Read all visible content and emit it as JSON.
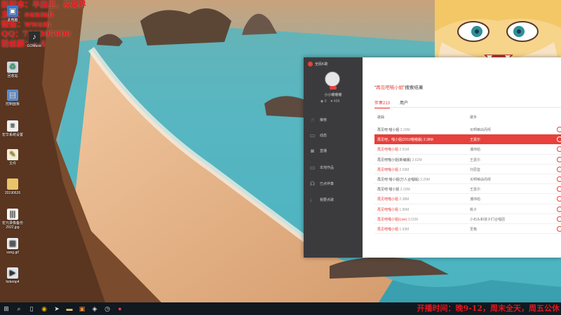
{
  "overlay": {
    "lines": [
      "新版本：半田里，灰莫界",
      "主播：eanmb",
      "微信：wwam",
      "QQ：739305908",
      "粉丝群：1.4"
    ]
  },
  "desktop_icons": [
    {
      "label": "此电脑",
      "icon": "computer-icon"
    },
    {
      "label": "GOMusic",
      "icon": "music-app-icon"
    },
    {
      "label": "回收站",
      "icon": "recycle-bin-icon"
    },
    {
      "label": "控制面板",
      "icon": "control-panel-icon"
    },
    {
      "label": "宏华系统设置",
      "icon": "settings-file-icon"
    },
    {
      "label": "文件",
      "icon": "file-icon"
    },
    {
      "label": "20190626",
      "icon": "folder-icon"
    },
    {
      "label": "宏元录像备份2922.jpg",
      "icon": "image-file-icon"
    },
    {
      "label": "song.gif",
      "icon": "image-file-icon"
    },
    {
      "label": "hidemp4",
      "icon": "video-file-icon"
    }
  ],
  "app": {
    "title": "全民K歌",
    "user": {
      "name": "小小暖暖暖",
      "followers": "0",
      "following": "439"
    },
    "nav": [
      {
        "label": "推荐",
        "icon": "thumb-icon"
      },
      {
        "label": "动态",
        "icon": "chat-icon"
      },
      {
        "label": "直播",
        "icon": "camera-icon"
      },
      {
        "label": "本地作品",
        "icon": "monitor-icon"
      },
      {
        "label": "已点伴奏",
        "icon": "headset-icon"
      },
      {
        "label": "我要点歌",
        "icon": "microphone-icon"
      }
    ],
    "search": {
      "keyword": "再见吧喵小姐",
      "suffix": "搜索结果"
    },
    "tabs": [
      {
        "label": "伴奏213",
        "active": true
      },
      {
        "label": "用户",
        "active": false
      }
    ],
    "columns": {
      "song": "歌曲",
      "singer": "歌手"
    },
    "results": [
      {
        "song": "再见吧 喵小姐",
        "size": "2.20M",
        "singer": "买啊嘛由而呀",
        "red": false,
        "selected": false
      },
      {
        "song": "再见吧，喵小姐(2019喵喵版)",
        "size": "2.38M",
        "singer": "王嘉尔",
        "red": false,
        "selected": true
      },
      {
        "song": "再见吧喵小姐",
        "size": "2.51M",
        "singer": "潘玮柏",
        "red": true,
        "selected": false
      },
      {
        "song": "再见吧喵小姐(新编版)",
        "size": "2.62M",
        "singer": "王嘉尔",
        "red": false,
        "selected": false
      },
      {
        "song": "再见吧喵小姐",
        "size": "2.03M",
        "singer": "刘思鉴",
        "red": true,
        "selected": false
      },
      {
        "song": "再见吧 喵小姐(万人合唱版)",
        "size": "2.20M",
        "singer": "买啊嘛由而呀",
        "red": false,
        "selected": false
      },
      {
        "song": "再见吧 喵小姐",
        "size": "2.03M",
        "singer": "王嘉尔",
        "red": false,
        "selected": false
      },
      {
        "song": "再见吧喵小姐",
        "size": "2.38M",
        "singer": "潘玮柏",
        "red": true,
        "selected": false
      },
      {
        "song": "再见吧喵小姐",
        "size": "1.90M",
        "singer": "桃子",
        "red": true,
        "selected": false
      },
      {
        "song": "再见吧喵小姐(Live)",
        "size": "3.01M",
        "singer": "小石头和孩子们合唱团",
        "red": true,
        "selected": false
      },
      {
        "song": "再见吧喵小姐",
        "size": "1.93M",
        "singer": "圣格",
        "red": true,
        "selected": false
      }
    ]
  },
  "taskbar": {
    "items": [
      "windows-start-icon",
      "search-icon",
      "task-view-icon",
      "chrome-icon",
      "arrow-icon",
      "file-explorer-icon",
      "media-icon",
      "game-icon",
      "clock-icon",
      "karaoke-icon"
    ]
  },
  "ticker": "开播时间：晚9-12，周末全天，周五公休"
}
